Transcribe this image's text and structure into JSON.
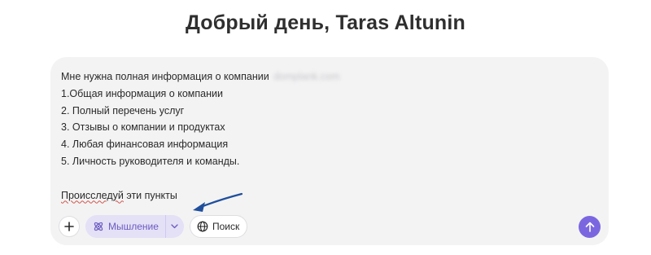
{
  "greeting": "Добрый день, Taras Altunin",
  "prompt": {
    "intro": "Мне нужна полная информация о компании",
    "company_blurred": "domplank.com",
    "items": [
      "1.Общая информация о компании",
      "2. Полный перечень услуг",
      "3. Отзывы о компании и продуктах",
      "4. Любая финансовая информация",
      "5. Личность руководителя и команды."
    ],
    "closing_word": "Происследуй",
    "closing_rest": " эти пункты"
  },
  "toolbar": {
    "add_icon": "plus-icon",
    "thinking_label": "Мышление",
    "thinking_icon": "atom-icon",
    "thinking_chevron_icon": "chevron-down-icon",
    "search_label": "Поиск",
    "search_icon": "globe-icon",
    "send_icon": "arrow-up-icon"
  },
  "colors": {
    "accent": "#7a67e0",
    "thinking_bg": "#e4e0f6",
    "annotation_arrow": "#1f4f9c"
  }
}
